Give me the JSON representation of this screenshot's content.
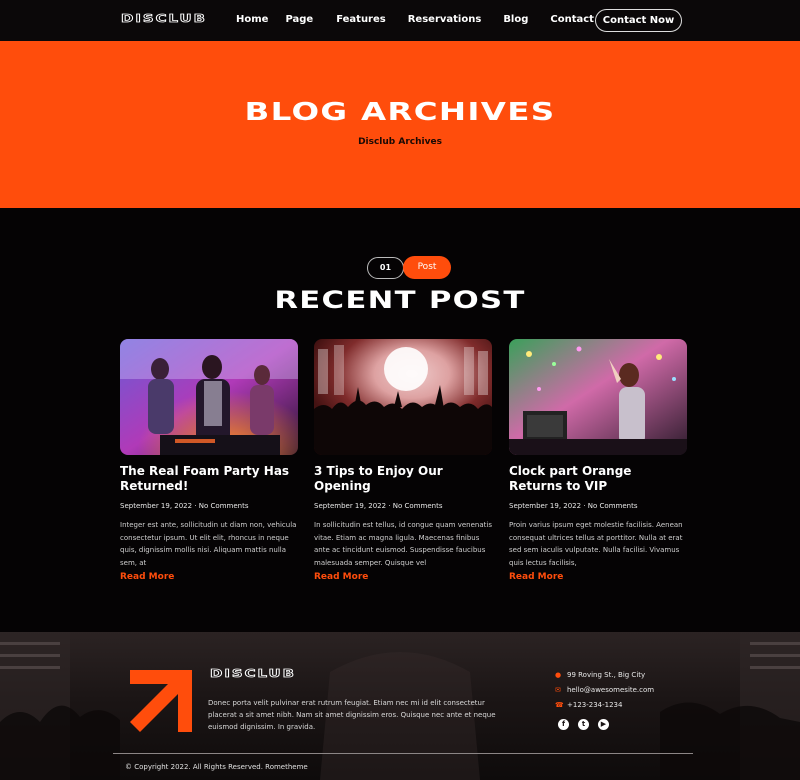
{
  "header": {
    "logo": "DISCLUB",
    "nav": [
      "Home",
      "Page",
      "Features",
      "Reservations",
      "Blog",
      "Contact"
    ],
    "contact_button": "Contact Now"
  },
  "hero": {
    "title": "BLOG ARCHIVES",
    "subtitle": "Disclub Archives"
  },
  "section": {
    "tag_number": "01",
    "tag_label": "Post",
    "title": "RECENT POST"
  },
  "posts": [
    {
      "title": "The Real Foam Party Has Returned!",
      "date": "September 19, 2022",
      "separator": "·",
      "comments": "No Comments",
      "excerpt": "Integer est ante, sollicitudin ut diam non, vehicula consectetur ipsum. Ut elit elit, rhoncus in neque quis, dignissim mollis nisi. Aliquam mattis nulla sem, at",
      "read_more": "Read More"
    },
    {
      "title": "3 Tips to Enjoy Our Opening",
      "date": "September 19, 2022",
      "separator": "·",
      "comments": "No Comments",
      "excerpt": "In sollicitudin est tellus, id congue quam venenatis vitae. Etiam ac magna ligula. Maecenas finibus ante ac tincidunt euismod. Suspendisse faucibus malesuada semper. Quisque vel",
      "read_more": "Read More"
    },
    {
      "title": "Clock part Orange Returns to VIP",
      "date": "September 19, 2022",
      "separator": "·",
      "comments": "No Comments",
      "excerpt": "Proin varius ipsum eget molestie facilisis. Aenean consequat ultrices tellus at porttitor. Nulla at erat sed sem iaculis vulputate. Nulla facilisi. Vivamus quis lectus facilisis,",
      "read_more": "Read More"
    }
  ],
  "footer": {
    "logo": "DISCLUB",
    "description": "Donec porta velit pulvinar erat rutrum feugiat. Etiam nec mi id elit consectetur placerat a sit amet nibh. Nam sit amet dignissim eros. Quisque nec ante et neque euismod dignissim. In gravida.",
    "address": "99 Roving St., Big City",
    "email": "hello@awesomesite.com",
    "phone": "+123-234-1234",
    "socials": [
      "facebook-icon",
      "twitter-icon",
      "youtube-icon"
    ],
    "copyright": "© Copyright 2022. All Rights Reserved. Rometheme"
  },
  "colors": {
    "accent": "#ff4d0c",
    "background": "#050304",
    "header": "#0b0809"
  }
}
